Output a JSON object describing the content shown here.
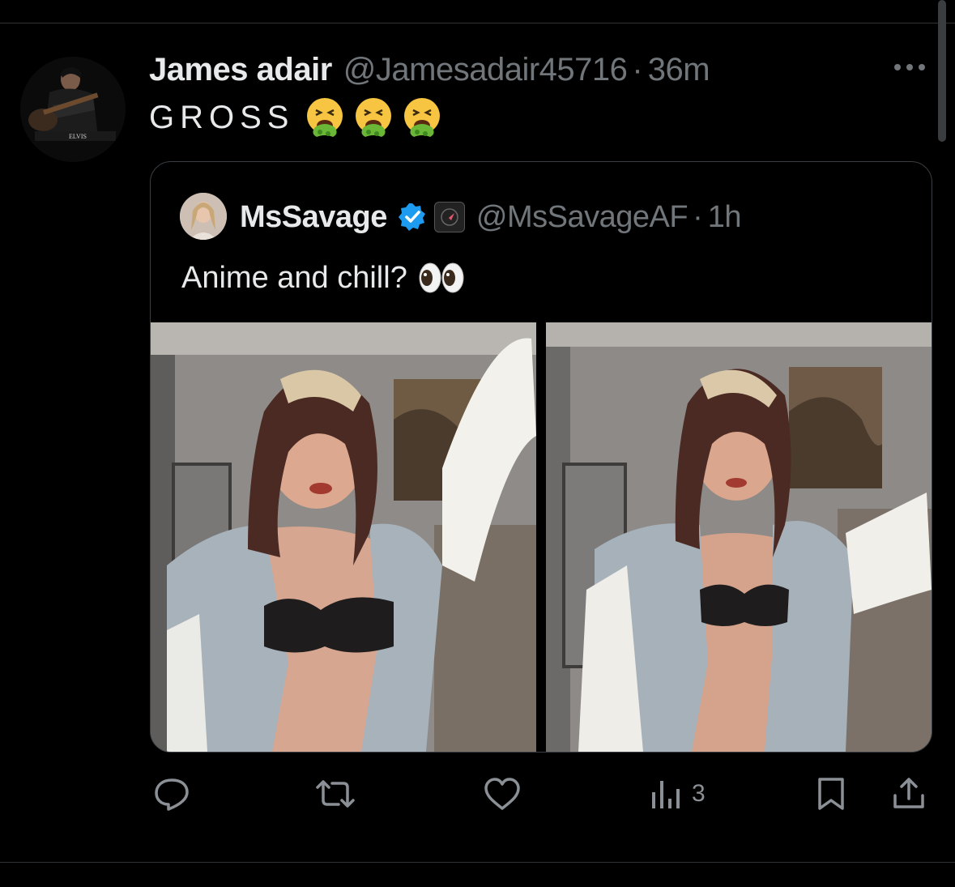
{
  "tweet": {
    "author_name": "James adair",
    "author_handle": "@Jamesadair45716",
    "separator": "·",
    "time": "36m",
    "text": "GROSS",
    "emojis": [
      "face-vomiting-emoji",
      "face-vomiting-emoji",
      "face-vomiting-emoji"
    ]
  },
  "quote": {
    "author_name": "MsSavage",
    "author_handle": "@MsSavageAF",
    "separator": "·",
    "time": "1h",
    "text": "Anime and chill?",
    "emoji": "eyes-emoji",
    "media": [
      "photo-1",
      "photo-2"
    ]
  },
  "actions": {
    "reply_icon": "reply-icon",
    "retweet_icon": "retweet-icon",
    "like_icon": "like-icon",
    "views_icon": "views-icon",
    "views_count": "3",
    "bookmark_icon": "bookmark-icon",
    "share_icon": "share-icon"
  },
  "colors": {
    "background": "#000000",
    "text": "#e7e9ea",
    "secondary_text": "#71767b",
    "verified_blue": "#1d9bf0",
    "border": "#2f3336"
  }
}
